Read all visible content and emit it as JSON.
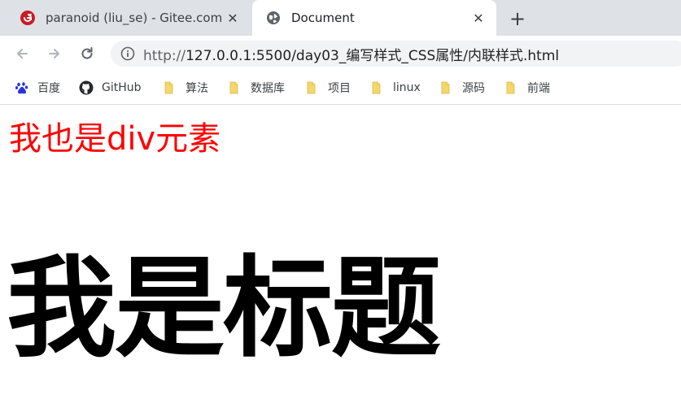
{
  "tabs": [
    {
      "title": "paranoid (liu_se) - Gitee.com",
      "favicon": "gitee-icon",
      "active": false
    },
    {
      "title": "Document",
      "favicon": "globe-icon",
      "active": true
    }
  ],
  "toolbar": {
    "url_scheme": "http://",
    "url_rest": "127.0.0.1:5500/day03_编写样式_CSS属性/内联样式.html"
  },
  "bookmarks": [
    {
      "label": "百度",
      "icon": "baidu-paw-icon"
    },
    {
      "label": "GitHub",
      "icon": "github-icon"
    },
    {
      "label": "算法",
      "icon": "folder-icon"
    },
    {
      "label": "数据库",
      "icon": "folder-icon"
    },
    {
      "label": "项目",
      "icon": "folder-icon"
    },
    {
      "label": "linux",
      "icon": "folder-icon"
    },
    {
      "label": "源码",
      "icon": "folder-icon"
    },
    {
      "label": "前端",
      "icon": "folder-icon"
    }
  ],
  "page": {
    "div_text": "我也是div元素",
    "heading_text": "我是标题"
  },
  "colors": {
    "tabstrip_bg": "#dee1e6",
    "div_text_color": "#ff0000",
    "gitee_red": "#c71d23",
    "folder_yellow": "#f5d66a",
    "baidu_blue": "#2932e1"
  }
}
